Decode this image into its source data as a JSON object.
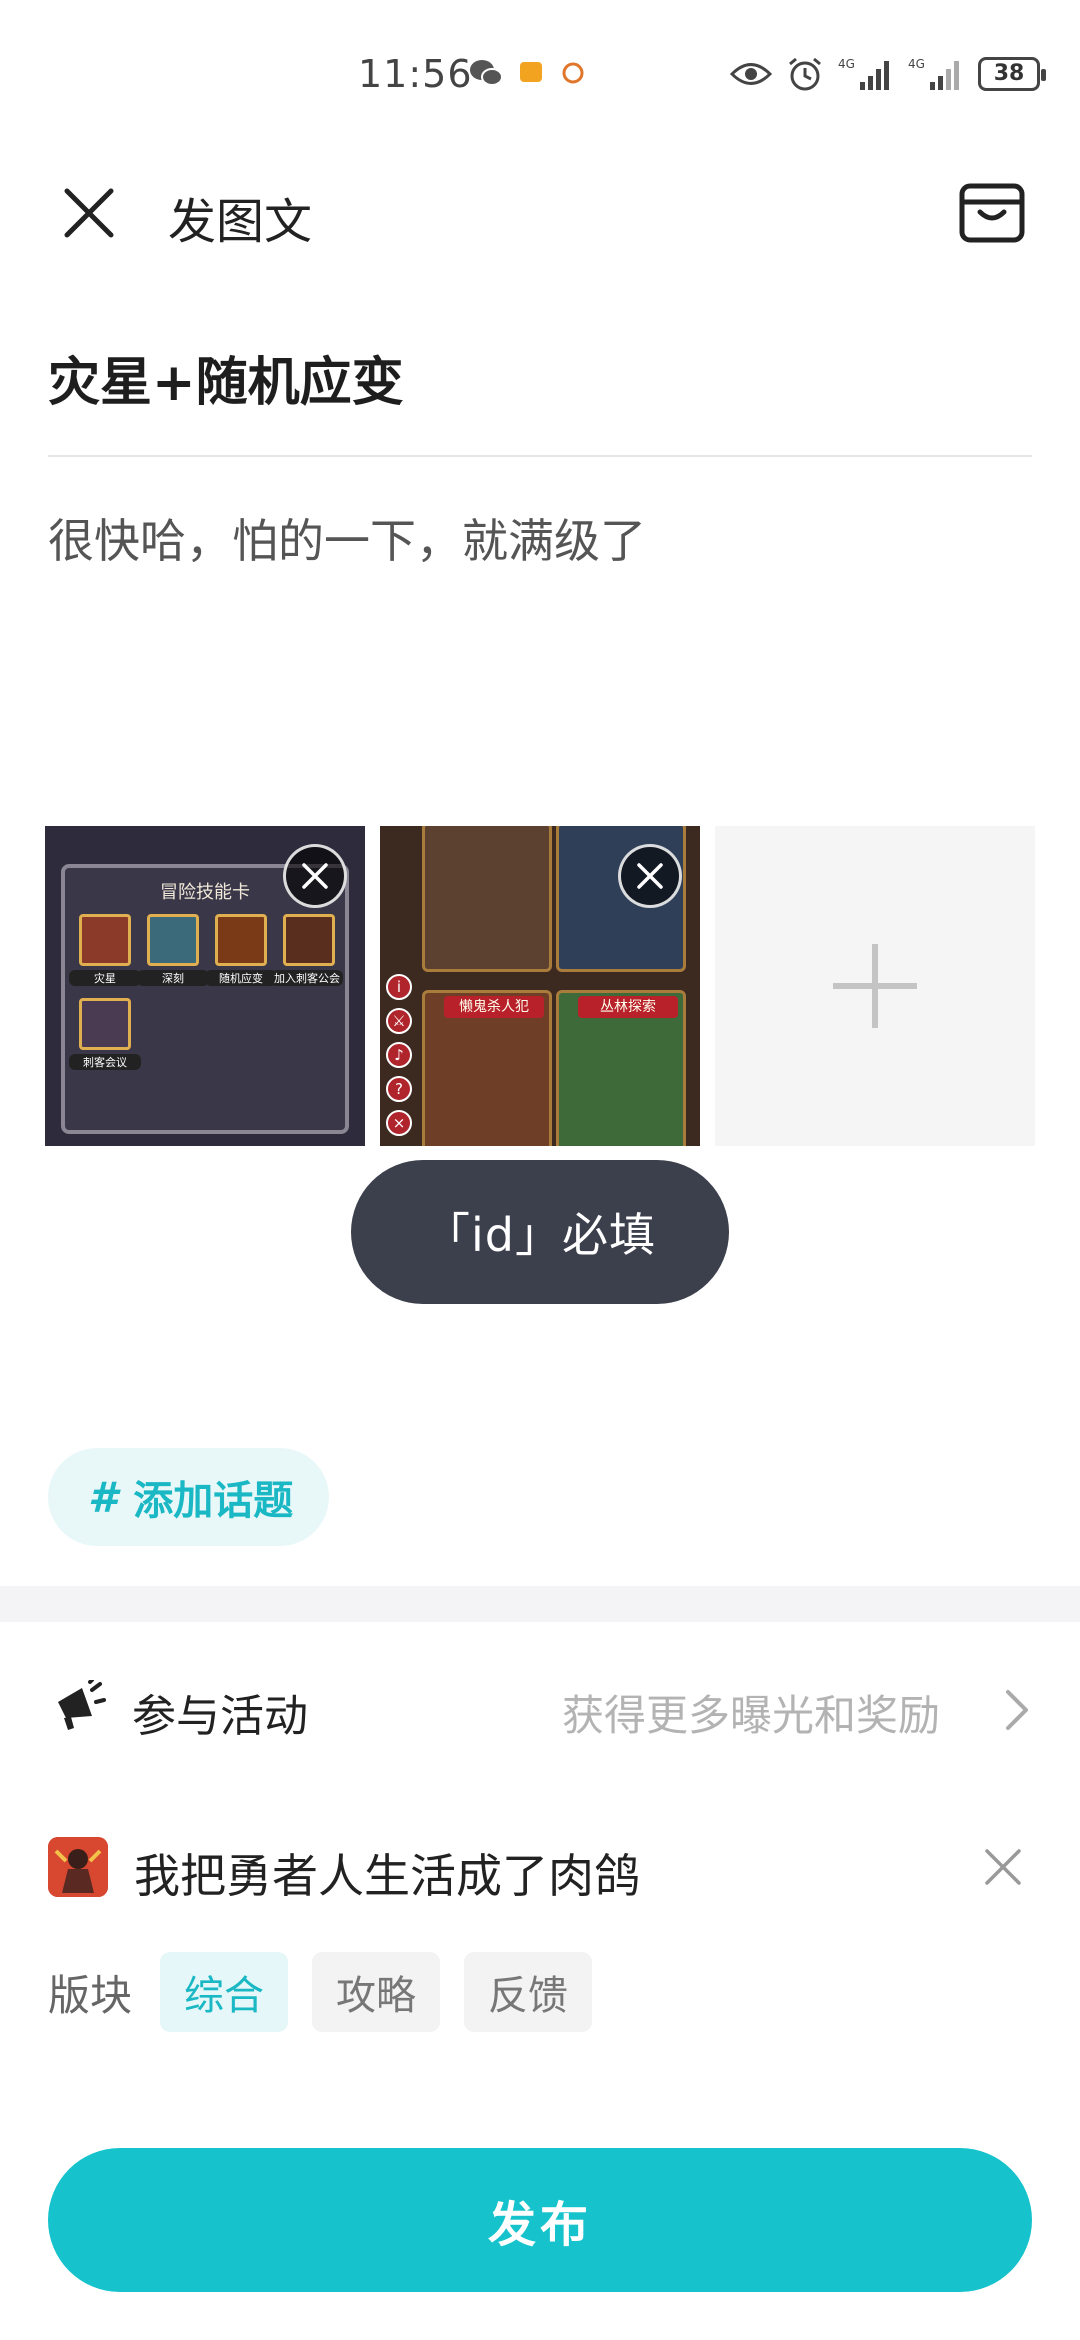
{
  "status_bar": {
    "time": "11:56",
    "battery": "38",
    "network_1": "4G",
    "network_2": "4G"
  },
  "header": {
    "title": "发图文"
  },
  "post": {
    "title": "灾星+随机应变",
    "body": "很快哈，怕的一下，就满级了"
  },
  "images": {
    "thumb1": {
      "panel_title": "冒险技能卡",
      "skills": [
        "灾星",
        "深刻",
        "随机应变",
        "加入刺客公会",
        "刺客会议"
      ]
    },
    "thumb2": {
      "ribbons": [
        "懒鬼杀人犯",
        "丛林探索"
      ]
    }
  },
  "toast": {
    "text": "「id」必填"
  },
  "topic": {
    "hash": "#",
    "label": "添加话题"
  },
  "activity": {
    "label": "参与活动",
    "hint": "获得更多曝光和奖励"
  },
  "game": {
    "name": "我把勇者人生活成了肉鸽"
  },
  "sections": {
    "label": "版块",
    "options": [
      "综合",
      "攻略",
      "反馈"
    ],
    "selected": "综合"
  },
  "publish": {
    "label": "发布"
  },
  "colors": {
    "accent": "#16c3cc",
    "toast_bg": "#3c3f4c"
  }
}
